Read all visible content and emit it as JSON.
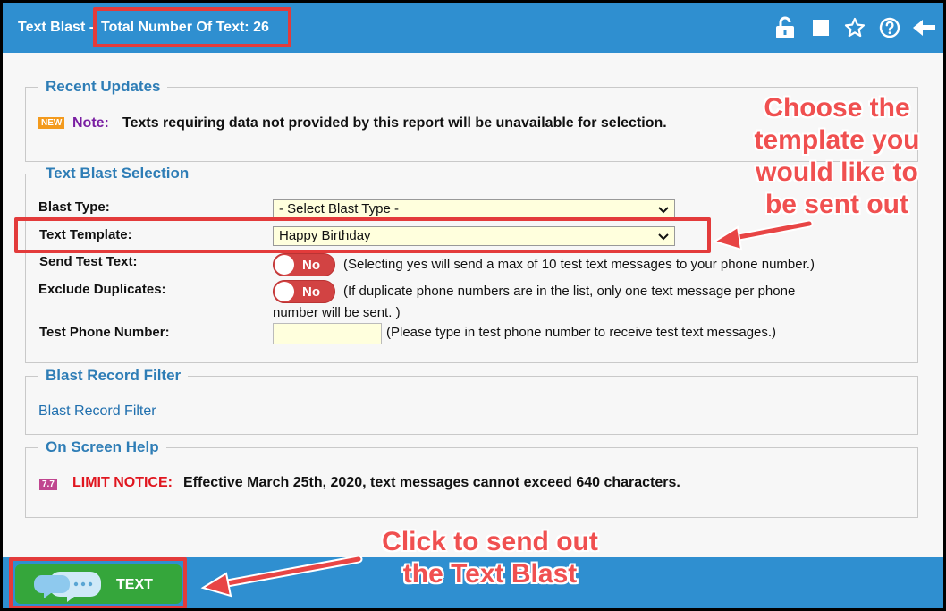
{
  "header": {
    "title": "Text Blast -",
    "total_text": "Total Number Of Text: 26",
    "icons": [
      "unlock-icon",
      "stop-icon",
      "star-icon",
      "help-icon",
      "back-arrow-icon"
    ]
  },
  "recent_updates": {
    "legend": "Recent Updates",
    "badge": "NEW",
    "note_label": "Note:",
    "note_text": "Texts requiring data not provided by this report will be unavailable for selection."
  },
  "selection": {
    "legend": "Text Blast Selection",
    "blast_type_label": "Blast Type:",
    "blast_type_value": "- Select Blast Type -",
    "template_label": "Text Template:",
    "template_value": "Happy Birthday",
    "send_test_label": "Send Test Text:",
    "send_test_toggle": "No",
    "send_test_hint": "(Selecting yes will send a max of 10 test text messages to your phone number.)",
    "exclude_label": "Exclude Duplicates:",
    "exclude_toggle": "No",
    "exclude_hint_1": "(If duplicate phone numbers are in the list, only one text message per phone",
    "exclude_hint_2": "number will be sent. )",
    "phone_label": "Test Phone Number:",
    "phone_value": "",
    "phone_hint": "(Please type in test phone number to receive test text messages.)"
  },
  "filter": {
    "legend": "Blast Record Filter",
    "link": "Blast Record Filter"
  },
  "help": {
    "legend": "On Screen Help",
    "badge": "7.7",
    "limit_label": "LIMIT NOTICE:",
    "limit_text": "Effective March 25th, 2020, text messages cannot exceed 640 characters."
  },
  "footer": {
    "text_button": "TEXT"
  },
  "annotations": {
    "choose_template": [
      "Choose the",
      "template you",
      "would like to",
      "be sent out"
    ],
    "click_send": [
      "Click to send out",
      "the Text Blast"
    ]
  },
  "colors": {
    "header_blue": "#2f8fd0",
    "accent_red": "#e33b3b",
    "link_blue": "#2e7db6",
    "button_green": "#35a63b"
  }
}
